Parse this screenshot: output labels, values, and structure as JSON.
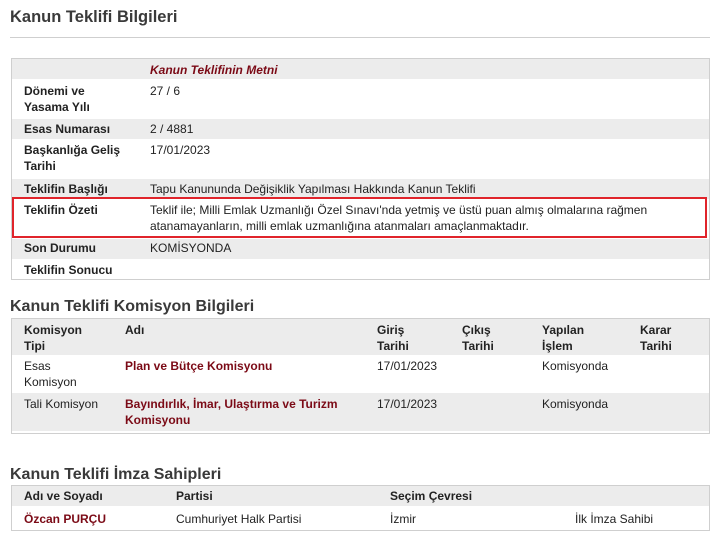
{
  "sections": {
    "info_title": "Kanun Teklifi Bilgileri",
    "commission_title": "Kanun Teklifi Komisyon Bilgileri",
    "signers_title": "Kanun Teklifi İmza Sahipleri"
  },
  "info": {
    "text_link": "Kanun Teklifinin Metni",
    "rows": [
      {
        "label": "Dönemi ve Yasama Yılı",
        "label_l1": "Dönemi ve",
        "label_l2": "Yasama Yılı",
        "value": "27 / 6"
      },
      {
        "label": "Esas Numarası",
        "value": "2 / 4881"
      },
      {
        "label": "Başkanlığa Geliş Tarihi",
        "label_l1": "Başkanlığa Geliş",
        "label_l2": "Tarihi",
        "value": "17/01/2023"
      },
      {
        "label": "Teklifin Başlığı",
        "value": "Tapu Kanununda Değişiklik Yapılması Hakkında Kanun Teklifi"
      },
      {
        "label": "Teklifin Özeti",
        "value_l1": "Teklif ile; Milli Emlak Uzmanlığı Özel Sınavı'nda yetmiş ve üstü puan almış olmalarına rağmen",
        "value_l2": "atanamayanların, milli emlak uzmanlığına atanmaları amaçlanmaktadır."
      },
      {
        "label": "Son Durumu",
        "value": "KOMİSYONDA"
      },
      {
        "label": "Teklifin Sonucu",
        "value": ""
      }
    ]
  },
  "commission": {
    "headers": {
      "type_l1": "Komisyon",
      "type_l2": "Tipi",
      "name": "Adı",
      "in_l1": "Giriş",
      "in_l2": "Tarihi",
      "out_l1": "Çıkış",
      "out_l2": "Tarihi",
      "op_l1": "Yapılan",
      "op_l2": "İşlem",
      "dec_l1": "Karar",
      "dec_l2": "Tarihi"
    },
    "rows": [
      {
        "type_l1": "Esas",
        "type_l2": "Komisyon",
        "name_l1": "Plan ve Bütçe Komisyonu",
        "name_l2": "",
        "in": "17/01/2023",
        "out": "",
        "op": "Komisyonda",
        "dec": ""
      },
      {
        "type_l1": "Tali Komisyon",
        "type_l2": "",
        "name_l1": "Bayındırlık, İmar, Ulaştırma ve Turizm",
        "name_l2": "Komisyonu",
        "in": "17/01/2023",
        "out": "",
        "op": "Komisyonda",
        "dec": ""
      }
    ]
  },
  "signers": {
    "headers": {
      "name": "Adı ve Soyadı",
      "party": "Partisi",
      "district": "Seçim Çevresi"
    },
    "rows": [
      {
        "name": "Özcan PURÇU",
        "party": "Cumhuriyet Halk Partisi",
        "district": "İzmir",
        "role": "İlk İmza Sahibi"
      }
    ]
  }
}
